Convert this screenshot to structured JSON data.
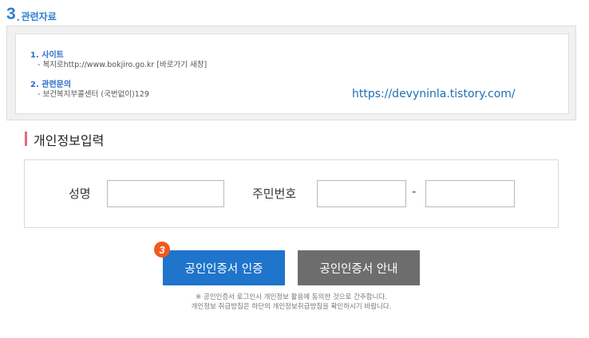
{
  "section": {
    "number": "3",
    "dot": ".",
    "title": "관련자료"
  },
  "related": {
    "items": [
      {
        "title": "1. 사이트",
        "desc": "- 복지로http://www.bokjiro.go.kr [바로가기 새창]"
      },
      {
        "title": "2. 관련문의",
        "desc": "- 보건복지부콜센터 (국번없이)129"
      }
    ]
  },
  "watermark": "https://devyninla.tistory.com/",
  "personal_info": {
    "title": "개인정보입력",
    "name_label": "성명",
    "name_value": "",
    "rrn_label": "주민번호",
    "rrn_first_value": "",
    "rrn_separator": "-",
    "rrn_second_value": ""
  },
  "buttons": {
    "step_badge": "3",
    "cert_login": "공인인증서 인증",
    "cert_guide": "공인인증서 안내"
  },
  "notes": {
    "line1": "※ 공인인증서 로그인시 개인정보 활용에 동의한 것으로 간주합니다.",
    "line2": "개인정보 취급방침은 하단의 개인정보취급방침을 확인하시기 바랍니다."
  },
  "colors": {
    "accent_blue": "#1f74cc",
    "section_blue": "#2e7fd1",
    "guide_gray": "#6d6d6d",
    "badge_orange": "#f05a1c",
    "title_bar_pink": "#e46a7a"
  }
}
